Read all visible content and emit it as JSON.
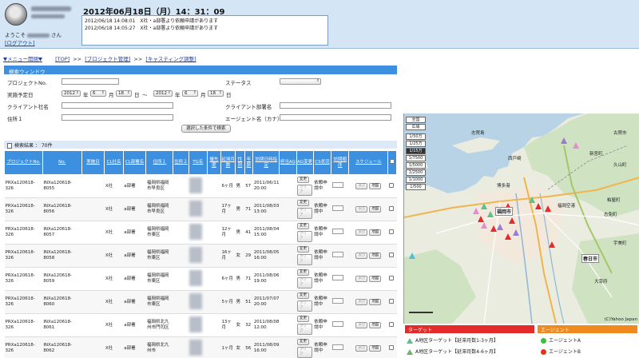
{
  "header": {
    "welcome_suffix": "さん",
    "welcome_prefix": "ようこそ",
    "logout": "[ログアウト]",
    "datetime": "2012年06月18日（月）14：31：09",
    "notices": [
      "2012/06/18 14:08:01　X社・a部署より依頼申請があります",
      "2012/06/18 14:05:27　X社・a部署より依頼申請があります"
    ]
  },
  "breadcrumb": {
    "menu": "▼メニュー開閉▼",
    "top": "[TOP]",
    "project": "[プロジェクト管理]",
    "casting": "[キャスティング調整]",
    "sep": ">>"
  },
  "search": {
    "title": "検索ウィンドウ",
    "project_no": "プロジェクトNo.",
    "status": "ステータス",
    "schedule": "実施予定日",
    "from": {
      "year": "2012",
      "month": "6",
      "day": "18"
    },
    "to": {
      "year": "2012",
      "month": "6",
      "day": "18"
    },
    "unit_year": "年",
    "unit_month": "月",
    "unit_day": "日",
    "tilde": "〜",
    "client": "クライアント社名",
    "client_dept": "クライアント部署名",
    "address": "住所１",
    "agent": "エージェント名（カナ）",
    "button": "選択した条件で検索"
  },
  "results": {
    "count": "検索結果 ： 70件",
    "headers": [
      "プロジェクトNo.",
      "No.",
      "実施日",
      "CL社名",
      "CL部署名",
      "住所１",
      "住所２",
      "TG名",
      "優先度",
      "延滞月数",
      "性別",
      "年齢",
      "訪問日時指定",
      "担当AG",
      "AG変更",
      "CS状況",
      "訪問順序",
      "スケジュール",
      ""
    ],
    "rows": [
      {
        "proj": "PRXa120618-326",
        "no": "INXa120618-8055",
        "cl": "X社",
        "dept": "a部署",
        "addr": "福岡県福岡市早良区",
        "pri": "",
        "months": "6ヶ月",
        "sex": "男",
        "age": "57",
        "date": "2011/06/11 20:00"
      },
      {
        "proj": "PRXa120618-326",
        "no": "INXa120618-8056",
        "cl": "X社",
        "dept": "a部署",
        "addr": "福岡県福岡市早良区",
        "pri": "",
        "months": "17ヶ月",
        "sex": "男",
        "age": "71",
        "date": "2011/08/03 13:00"
      },
      {
        "proj": "PRXa120618-326",
        "no": "INXa120618-8057",
        "cl": "X社",
        "dept": "a部署",
        "addr": "福岡県福岡市東区",
        "pri": "",
        "months": "12ヶ月",
        "sex": "男",
        "age": "41",
        "date": "2011/08/04 15:00"
      },
      {
        "proj": "PRXa120618-326",
        "no": "INXa120618-8058",
        "cl": "X社",
        "dept": "a部署",
        "addr": "福岡県福岡市東区",
        "pri": "",
        "months": "16ヶ月",
        "sex": "女",
        "age": "29",
        "date": "2011/08/05 16:00"
      },
      {
        "proj": "PRXa120618-326",
        "no": "INXa120618-8059",
        "cl": "X社",
        "dept": "a部署",
        "addr": "福岡県福岡市東区",
        "pri": "",
        "months": "6ヶ月",
        "sex": "男",
        "age": "71",
        "date": "2011/08/06 19:00"
      },
      {
        "proj": "PRXa120618-326",
        "no": "INXa120618-8060",
        "cl": "X社",
        "dept": "a部署",
        "addr": "福岡県福岡市東区",
        "pri": "",
        "months": "5ヶ月",
        "sex": "男",
        "age": "51",
        "date": "2011/07/07 20:00"
      },
      {
        "proj": "PRXa120618-326",
        "no": "INXa120618-8061",
        "cl": "X社",
        "dept": "a部署",
        "addr": "福岡県北九州市門司区",
        "pri": "",
        "months": "13ヶ月",
        "sex": "女",
        "age": "32",
        "date": "2011/08/08 12:00"
      },
      {
        "proj": "PRXa120618-326",
        "no": "INXa120618-8062",
        "cl": "X社",
        "dept": "a部署",
        "addr": "福岡県北九州市",
        "pri": "",
        "months": "1ヶ月",
        "sex": "女",
        "age": "56",
        "date": "2011/08/09 16:00"
      }
    ],
    "btn_change": "変更",
    "btn_clear": "クリア",
    "cs_status": "依頼申請中",
    "btn_display": "表示",
    "btn_map": "地図"
  },
  "map": {
    "zoom_top": [
      "全国",
      "広域"
    ],
    "zoom_scales": [
      "1/50万",
      "1/25万",
      "1/15万",
      "1/7500",
      "1/5000",
      "1/2500",
      "1/1000",
      "1/500"
    ],
    "active_scale": "1/15万",
    "copyright": "(C)Yahoo Japan",
    "labels": [
      "福岡市",
      "福岡空港",
      "春日市",
      "博多港",
      "古賀市",
      "志免町",
      "粕屋町",
      "宇美町",
      "大宰府",
      "久山町",
      "新宮町",
      "西戸崎",
      "志賀島"
    ]
  },
  "legend": {
    "target_title": "ターゲット",
    "agent_title": "エージェント",
    "t1": "A地区ターゲット【延滞月数1-3ヶ月】",
    "t2": "A地区ターゲット【延滞月数4-6ヶ月】",
    "a1": "エージェントA",
    "a2": "エージェントB",
    "colors": {
      "target": "#e52a2a",
      "agent": "#f08a1c",
      "agentA": "#3cbf3c",
      "agentB": "#e8301a"
    }
  }
}
